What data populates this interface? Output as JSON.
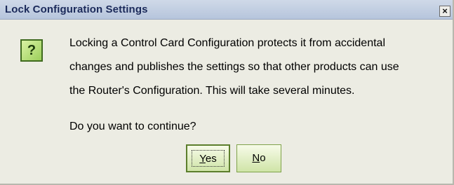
{
  "dialog": {
    "title": "Lock Configuration Settings",
    "close_glyph": "×",
    "icon": "question-icon",
    "icon_glyph": "?",
    "message_lines": [
      "Locking a Control Card Configuration protects it from accidental",
      "changes and publishes the settings so that other products can use",
      "the Router's Configuration.  This will take several minutes."
    ],
    "prompt": "Do you want to continue?",
    "buttons": {
      "yes_mnemonic": "Y",
      "yes_rest": "es",
      "no_mnemonic": "N",
      "no_rest": "o"
    }
  }
}
